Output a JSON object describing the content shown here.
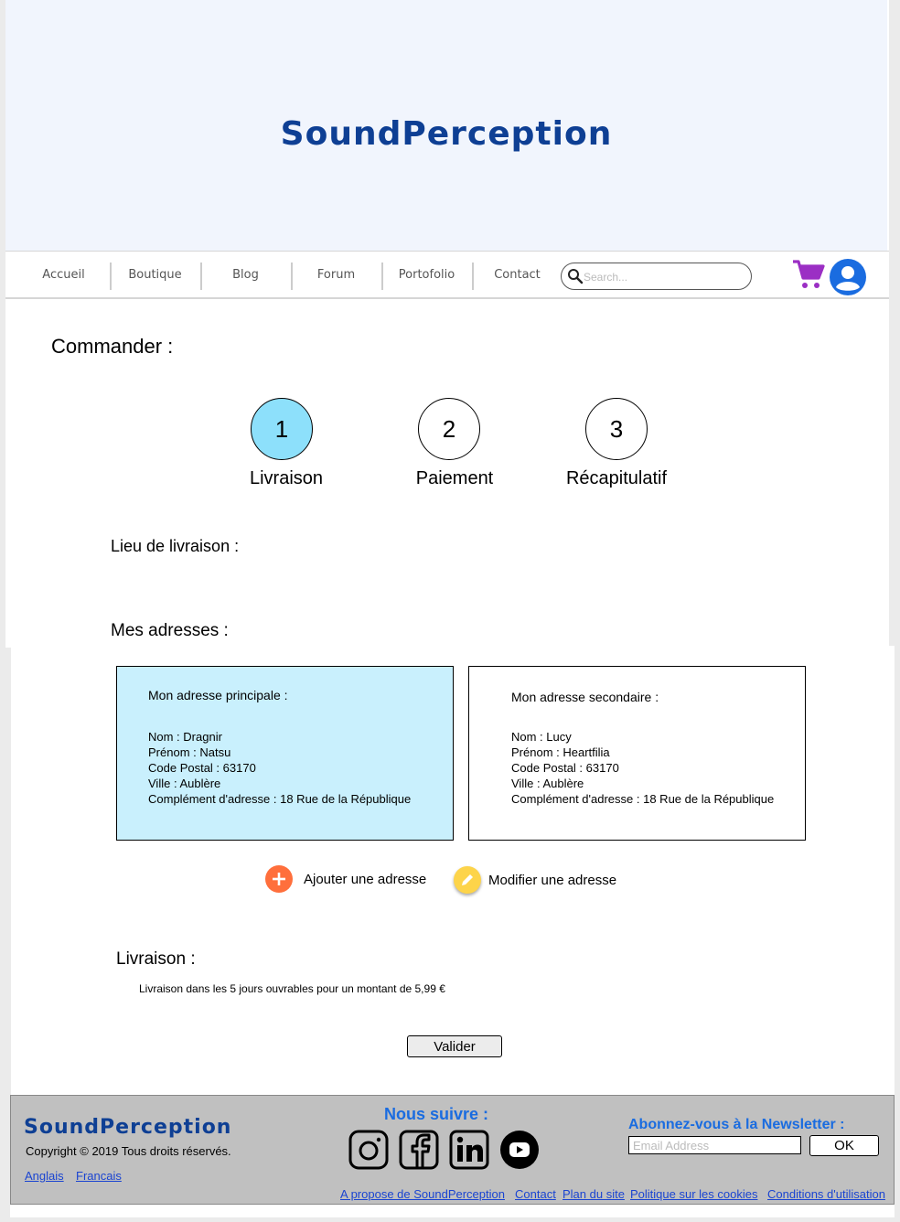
{
  "header": {
    "brand": "SoundPerception"
  },
  "nav": {
    "items": [
      "Accueil",
      "Boutique",
      "Blog",
      "Forum",
      "Portofolio",
      "Contact"
    ],
    "search_placeholder": "Search..."
  },
  "order": {
    "title": "Commander :",
    "steps": [
      {
        "number": "1",
        "label": "Livraison",
        "active": true
      },
      {
        "number": "2",
        "label": "Paiement",
        "active": false
      },
      {
        "number": "3",
        "label": "Récapitulatif",
        "active": false
      }
    ],
    "lieu_title": "Lieu de livraison :",
    "addresses_title": "Mes adresses :",
    "addresses": [
      {
        "title": "Mon adresse principale :",
        "nom": "Nom : Dragnir",
        "prenom": "Prénom : Natsu",
        "code_postal": "Code Postal : 63170",
        "ville": "Ville : Aublère",
        "complement": "Complément d'adresse : 18 Rue de la République",
        "selected": true
      },
      {
        "title": "Mon adresse secondaire :",
        "nom": "Nom : Lucy",
        "prenom": "Prénom : Heartfilia",
        "code_postal": "Code Postal : 63170",
        "ville": "Ville : Aublère",
        "complement": "Complément d'adresse : 18 Rue de la République",
        "selected": false
      }
    ],
    "add_address": "Ajouter une adresse",
    "edit_address": "Modifier une adresse",
    "delivery_title": "Livraison :",
    "delivery_text": "Livraison dans les 5 jours ouvrables pour un montant de 5,99 €",
    "submit": "Valider"
  },
  "footer": {
    "brand": "SoundPerception",
    "copyright": "Copyright © 2019 Tous droits réservés.",
    "languages": [
      "Anglais",
      "Francais"
    ],
    "follow_title": "Nous suivre :",
    "socials": [
      "instagram-icon",
      "facebook-icon",
      "linkedin-icon",
      "youtube-icon"
    ],
    "newsletter_title": "Abonnez-vous à la Newsletter :",
    "email_placeholder": "Email Address",
    "ok": "OK",
    "links": [
      "A propose de SoundPerception",
      "Contact",
      "Plan du site",
      "Politique sur les cookies",
      "Conditions d'utilisation"
    ]
  },
  "colors": {
    "brand": "#0e3f94",
    "header_bg": "#f1f5fd",
    "active_step": "#8de0fb",
    "selected_card": "#c9f0fd",
    "add_button": "#ff6f3c",
    "edit_button": "#fdd44a",
    "cart": "#9b2fc4",
    "account": "#1a6ce0"
  }
}
